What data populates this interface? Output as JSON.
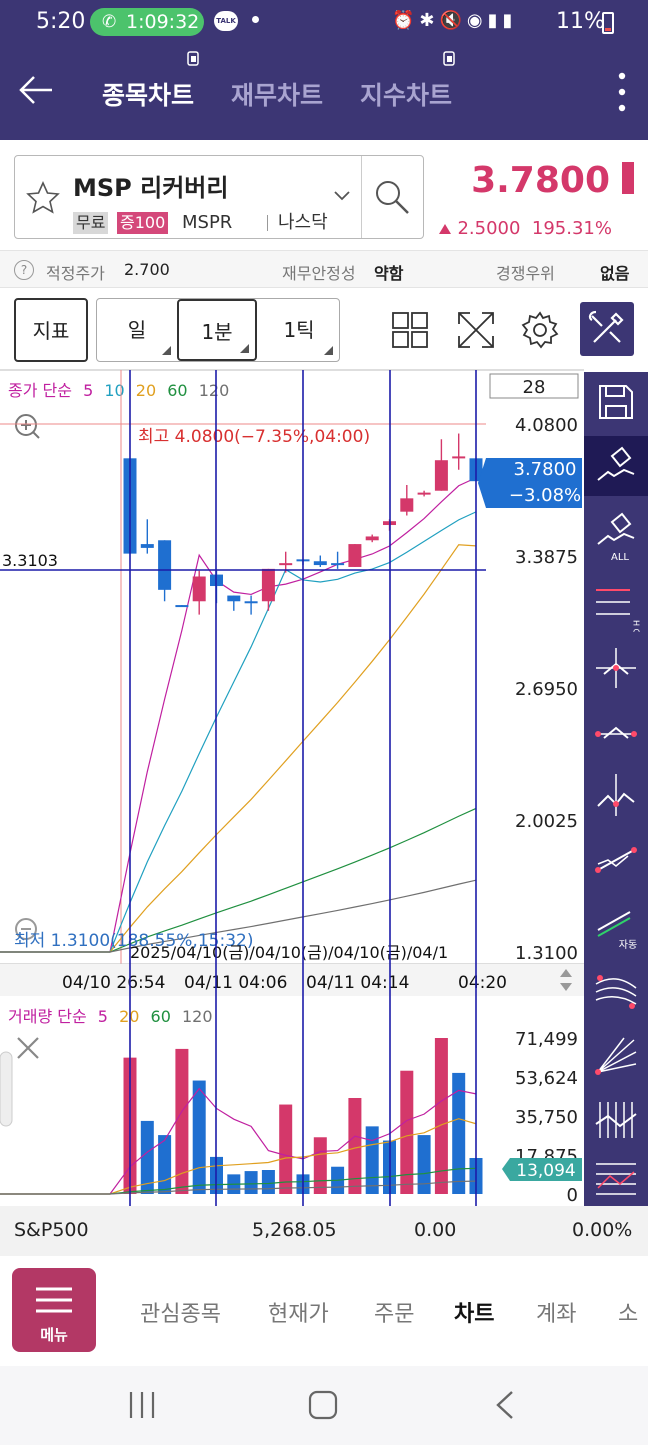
{
  "status_bar": {
    "time": "5:20",
    "call_duration": "1:09:32",
    "talk_icon_label": "TALK",
    "battery": "11%"
  },
  "header": {
    "tabs": [
      {
        "label": "종목차트",
        "active": true
      },
      {
        "label": "재무차트",
        "active": false
      },
      {
        "label": "지수차트",
        "active": false
      }
    ]
  },
  "stock": {
    "name": "MSP 리커버리",
    "tag_free": "무료",
    "tag_margin": "증100",
    "ticker": "MSPR",
    "market": "나스닥",
    "price": "3.7800",
    "change": "2.5000",
    "change_pct": "195.31%",
    "color_up": "#d4386a"
  },
  "info_row": {
    "help_icon": "?",
    "fair_price_label": "적정주가",
    "fair_price_value": "2.700",
    "stability_label": "재무안정성",
    "stability_value": "약함",
    "competitive_label": "경쟁우위",
    "competitive_value": "없음"
  },
  "toolbar": {
    "indicator_label": "지표",
    "periods": [
      {
        "label": "일",
        "selected": false
      },
      {
        "label": "1분",
        "selected": true
      },
      {
        "label": "1틱",
        "selected": false
      }
    ]
  },
  "chart": {
    "price_legend": {
      "prefix": "종가 단순",
      "ma": [
        "5",
        "10",
        "20",
        "60",
        "120"
      ],
      "ma_colors": [
        "#c020a0",
        "#20a0c0",
        "#e0a020",
        "#209040",
        "#707070"
      ]
    },
    "count_box": "28",
    "high_label": "최고 4.0800(−7.35%,04:00)",
    "low_label": "최저 1.3100(188.55%,15:32)",
    "crosshair_price": "3.3103",
    "current_price": "3.7800",
    "current_pct": "−3.08%",
    "y_ticks": [
      "4.0800",
      "3.3875",
      "2.6950",
      "2.0025",
      "1.3100"
    ],
    "x_ticks": [
      "04/10 26:54",
      "04/11 04:06",
      "04/11 04:14",
      "04:20"
    ],
    "overlap_date_label": "2025/04/10(금)/04/10(금)/04/10(금)/04/1",
    "volume_legend": {
      "prefix": "거래량 단순",
      "ma": [
        "5",
        "20",
        "60",
        "120"
      ],
      "ma_colors": [
        "#c020a0",
        "#e0a020",
        "#209040",
        "#707070"
      ]
    },
    "volume_ticks": [
      "71,499",
      "53,624",
      "35,750",
      "17,875",
      "0"
    ],
    "current_volume": "13,094",
    "panel_all_label": "ALL",
    "panel_hcl_label": "H C L",
    "panel_auto_label": "자동"
  },
  "chart_data": {
    "type": "candlestick",
    "ylim": [
      1.31,
      4.08
    ],
    "candles": [
      {
        "o": 3.4,
        "h": 3.9,
        "l": 3.4,
        "c": 3.9,
        "up": false
      },
      {
        "o": 3.43,
        "h": 3.58,
        "l": 3.4,
        "c": 3.45,
        "up": false
      },
      {
        "o": 3.47,
        "h": 3.47,
        "l": 3.15,
        "c": 3.21,
        "up": false
      },
      {
        "o": 3.13,
        "h": 3.13,
        "l": 3.12,
        "c": 3.12,
        "up": false
      },
      {
        "o": 3.15,
        "h": 3.31,
        "l": 3.08,
        "c": 3.28,
        "up": true
      },
      {
        "o": 3.29,
        "h": 3.31,
        "l": 3.14,
        "c": 3.23,
        "up": false
      },
      {
        "o": 3.18,
        "h": 3.18,
        "l": 3.1,
        "c": 3.15,
        "up": false
      },
      {
        "o": 3.15,
        "h": 3.18,
        "l": 3.08,
        "c": 3.15,
        "up": false
      },
      {
        "o": 3.15,
        "h": 3.32,
        "l": 3.1,
        "c": 3.32,
        "up": true
      },
      {
        "o": 3.35,
        "h": 3.41,
        "l": 3.3,
        "c": 3.35,
        "up": true
      },
      {
        "o": 3.37,
        "h": 3.37,
        "l": 3.34,
        "c": 3.36,
        "up": false
      },
      {
        "o": 3.36,
        "h": 3.39,
        "l": 3.33,
        "c": 3.34,
        "up": false
      },
      {
        "o": 3.35,
        "h": 3.41,
        "l": 3.32,
        "c": 3.35,
        "up": false
      },
      {
        "o": 3.33,
        "h": 3.45,
        "l": 3.33,
        "c": 3.45,
        "up": true
      },
      {
        "o": 3.47,
        "h": 3.5,
        "l": 3.46,
        "c": 3.49,
        "up": true
      },
      {
        "o": 3.55,
        "h": 3.58,
        "l": 3.52,
        "c": 3.57,
        "up": true
      },
      {
        "o": 3.62,
        "h": 3.76,
        "l": 3.6,
        "c": 3.69,
        "up": true
      },
      {
        "o": 3.71,
        "h": 3.73,
        "l": 3.7,
        "c": 3.72,
        "up": true
      },
      {
        "o": 3.73,
        "h": 4.0,
        "l": 3.73,
        "c": 3.89,
        "up": true
      },
      {
        "o": 3.9,
        "h": 4.03,
        "l": 3.84,
        "c": 3.91,
        "up": true
      },
      {
        "o": 3.9,
        "h": 3.9,
        "l": 3.78,
        "c": 3.78,
        "up": false
      }
    ],
    "volume_ylim": [
      0,
      71499
    ],
    "volumes": [
      {
        "v": 62500,
        "up": true
      },
      {
        "v": 33500,
        "up": false
      },
      {
        "v": 27000,
        "up": false
      },
      {
        "v": 66500,
        "up": true
      },
      {
        "v": 52000,
        "up": false
      },
      {
        "v": 17000,
        "up": false
      },
      {
        "v": 9000,
        "up": false
      },
      {
        "v": 10500,
        "up": false
      },
      {
        "v": 11000,
        "up": false
      },
      {
        "v": 41000,
        "up": true
      },
      {
        "v": 9000,
        "up": false
      },
      {
        "v": 26000,
        "up": true
      },
      {
        "v": 12500,
        "up": false
      },
      {
        "v": 44000,
        "up": true
      },
      {
        "v": 31000,
        "up": false
      },
      {
        "v": 24500,
        "up": false
      },
      {
        "v": 56500,
        "up": true
      },
      {
        "v": 27000,
        "up": false
      },
      {
        "v": 74000,
        "up": true
      },
      {
        "v": 55500,
        "up": false
      },
      {
        "v": 16500,
        "up": false
      }
    ]
  },
  "market": {
    "index_name": "S&P500",
    "index_value": "5,268.05",
    "index_change": "0.00",
    "index_pct": "0.00%"
  },
  "nav": {
    "menu_label": "메뉴",
    "items": [
      {
        "label": "관심종목",
        "active": false
      },
      {
        "label": "현재가",
        "active": false
      },
      {
        "label": "주문",
        "active": false
      },
      {
        "label": "차트",
        "active": true
      },
      {
        "label": "계좌",
        "active": false
      },
      {
        "label": "소",
        "active": false
      }
    ]
  }
}
